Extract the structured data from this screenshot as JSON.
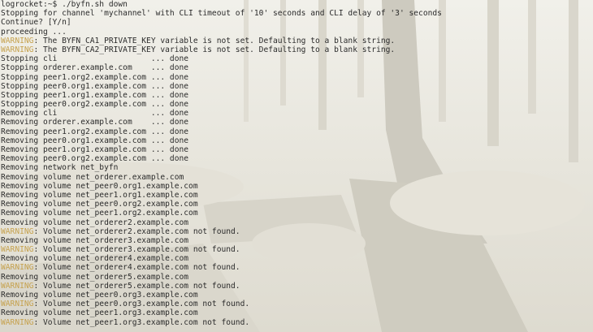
{
  "colors": {
    "text": "#2b2b2b",
    "warning": "#c6a24f",
    "background": "#e9e8e2"
  },
  "terminal": {
    "lines": [
      {
        "text": "logrocket:~$ ./byfn.sh down"
      },
      {
        "text": "Stopping for channel 'mychannel' with CLI timeout of '10' seconds and CLI delay of '3' seconds"
      },
      {
        "text": "Continue? [Y/n]"
      },
      {
        "text": "proceeding ..."
      },
      {
        "prefix": "WARNING",
        "text": ": The BYFN_CA1_PRIVATE_KEY variable is not set. Defaulting to a blank string."
      },
      {
        "prefix": "WARNING",
        "text": ": The BYFN_CA2_PRIVATE_KEY variable is not set. Defaulting to a blank string."
      },
      {
        "text": "Stopping cli                    ... done"
      },
      {
        "text": "Stopping orderer.example.com    ... done"
      },
      {
        "text": "Stopping peer1.org2.example.com ... done"
      },
      {
        "text": "Stopping peer0.org1.example.com ... done"
      },
      {
        "text": "Stopping peer1.org1.example.com ... done"
      },
      {
        "text": "Stopping peer0.org2.example.com ... done"
      },
      {
        "text": "Removing cli                    ... done"
      },
      {
        "text": "Removing orderer.example.com    ... done"
      },
      {
        "text": "Removing peer1.org2.example.com ... done"
      },
      {
        "text": "Removing peer0.org1.example.com ... done"
      },
      {
        "text": "Removing peer1.org1.example.com ... done"
      },
      {
        "text": "Removing peer0.org2.example.com ... done"
      },
      {
        "text": "Removing network net_byfn"
      },
      {
        "text": "Removing volume net_orderer.example.com"
      },
      {
        "text": "Removing volume net_peer0.org1.example.com"
      },
      {
        "text": "Removing volume net_peer1.org1.example.com"
      },
      {
        "text": "Removing volume net_peer0.org2.example.com"
      },
      {
        "text": "Removing volume net_peer1.org2.example.com"
      },
      {
        "text": "Removing volume net_orderer2.example.com"
      },
      {
        "prefix": "WARNING",
        "text": ": Volume net_orderer2.example.com not found."
      },
      {
        "text": "Removing volume net_orderer3.example.com"
      },
      {
        "prefix": "WARNING",
        "text": ": Volume net_orderer3.example.com not found."
      },
      {
        "text": "Removing volume net_orderer4.example.com"
      },
      {
        "prefix": "WARNING",
        "text": ": Volume net_orderer4.example.com not found."
      },
      {
        "text": "Removing volume net_orderer5.example.com"
      },
      {
        "prefix": "WARNING",
        "text": ": Volume net_orderer5.example.com not found."
      },
      {
        "text": "Removing volume net_peer0.org3.example.com"
      },
      {
        "prefix": "WARNING",
        "text": ": Volume net_peer0.org3.example.com not found."
      },
      {
        "text": "Removing volume net_peer1.org3.example.com"
      },
      {
        "prefix": "WARNING",
        "text": ": Volume net_peer1.org3.example.com not found."
      }
    ]
  }
}
